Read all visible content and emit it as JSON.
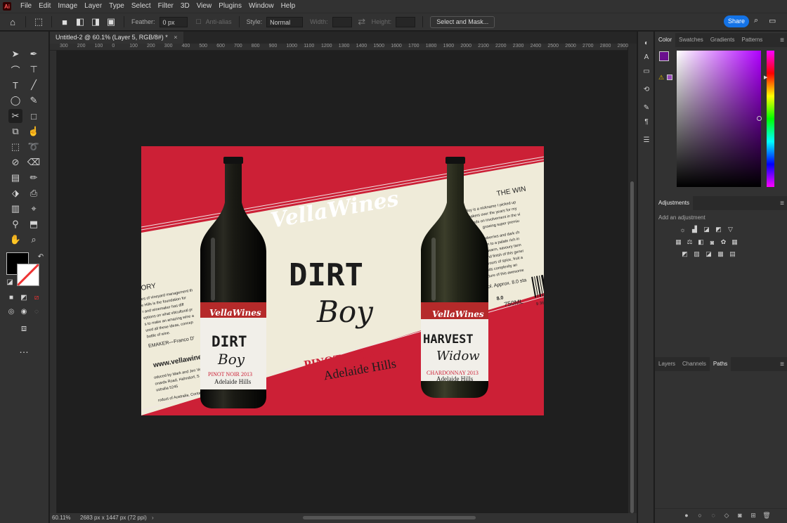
{
  "app": {
    "logo": "Ai",
    "menus": [
      "File",
      "Edit",
      "Image",
      "Layer",
      "Type",
      "Select",
      "Filter",
      "3D",
      "View",
      "Plugins",
      "Window",
      "Help"
    ]
  },
  "options_bar": {
    "feather_label": "Feather:",
    "feather_value": "0 px",
    "antialias_label": "Anti-alias",
    "style_label": "Style:",
    "style_value": "Normal",
    "width_label": "Width:",
    "height_label": "Height:",
    "select_mask_label": "Select and Mask...",
    "share_label": "Share"
  },
  "document": {
    "tab_title": "Untitled-2 @ 60.1% (Layer 5, RGB/8#) *",
    "zoom": "60.11%",
    "dimensions": "2683 px x 1447 px (72 ppi)"
  },
  "ruler": {
    "ticks": [
      "300",
      "200",
      "100",
      "0",
      "100",
      "200",
      "300",
      "400",
      "500",
      "600",
      "700",
      "800",
      "900",
      "1000",
      "1100",
      "1200",
      "1300",
      "1400",
      "1500",
      "1600",
      "1700",
      "1800",
      "1900",
      "2000",
      "2100",
      "2200",
      "2300",
      "2400",
      "2500",
      "2600",
      "2700",
      "2800",
      "2900"
    ]
  },
  "artwork": {
    "brand": "VellaWines",
    "main_title_1": "DIRT",
    "main_title_2": "Boy",
    "varietal": "PINOT NOIR 2013",
    "region": "Adelaide Hills",
    "story_heading": "TORY",
    "story_lines": [
      "ars of vineyard management th",
      "e Hills is the foundation for",
      "r and winemaker has diff",
      "eptions on what viticultural pr",
      "s to make an amazing wine a",
      "ured all these ideas, concep",
      "bottle of wine."
    ],
    "winemaker_line": "EMAKER—Franco D'",
    "website": "www.vellawines",
    "address_lines": [
      "oduced by Mark and Jen Ve",
      "onards Road, Hahndorf, S",
      "ustralia 5245"
    ],
    "product_line": "roduct of Australia. Conta",
    "right_heading": "THE WIN",
    "right_lines": [
      "Dirt Boy is a nickname I picked up",
      "winemakers over the years for my",
      "hands on involvement in the vi",
      "growing super premiu",
      "has strawberries and dark ch",
      "leading on to a palate rich in",
      "ries with warm, savoury tann",
      "length and finish of this gener",
      "dary flavours of spice, fruit a",
      "tract adds complexity an",
      "the texture of this awesome"
    ],
    "alc_line": "alc/vol.  Approx. 8.0 sta",
    "volume": "750ML",
    "std_drinks": "8.0",
    "barcode_digits": "9  36",
    "bottle1": {
      "brand": "VellaWines",
      "title1": "DIRT",
      "title2": "Boy",
      "varietal": "PINOT NOIR 2013",
      "region": "Adelaide Hills"
    },
    "bottle2": {
      "brand": "VellaWines",
      "title1": "HARVEST",
      "title2": "Widow",
      "varietal": "CHARDONNAY 2013",
      "region": "Adelaide Hills"
    }
  },
  "panels": {
    "color_tabs": [
      "Color",
      "Swatches",
      "Gradients",
      "Patterns"
    ],
    "adjustments_title": "Adjustments",
    "adjustments_subtitle": "Add an adjustment",
    "layers_tabs": [
      "Layers",
      "Channels",
      "Paths"
    ]
  },
  "colors": {
    "foreground": "#6a0f8e",
    "background": "#cc3a3a",
    "label_red": "#cc2036",
    "label_cream": "#efebd9",
    "accent_blue": "#1473e6"
  }
}
